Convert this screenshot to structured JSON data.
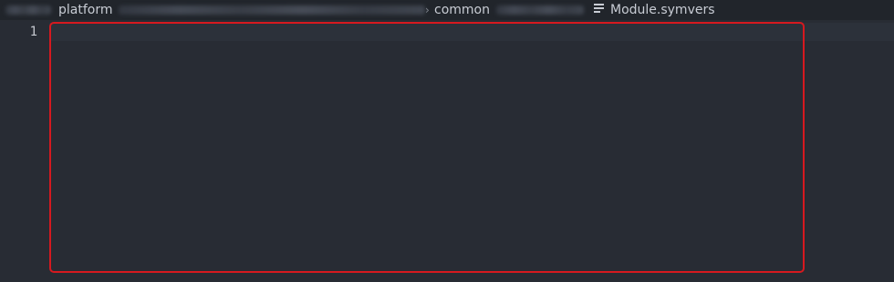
{
  "breadcrumb": {
    "items": [
      {
        "label": "platform"
      },
      {
        "label": "common"
      },
      {
        "label": "Module.symvers",
        "icon": "file-text-icon"
      }
    ]
  },
  "editor": {
    "line_numbers": [
      "1"
    ]
  },
  "colors": {
    "background": "#282c34",
    "breadcrumb_bg": "#21252b",
    "highlight_border": "#d6191f"
  }
}
